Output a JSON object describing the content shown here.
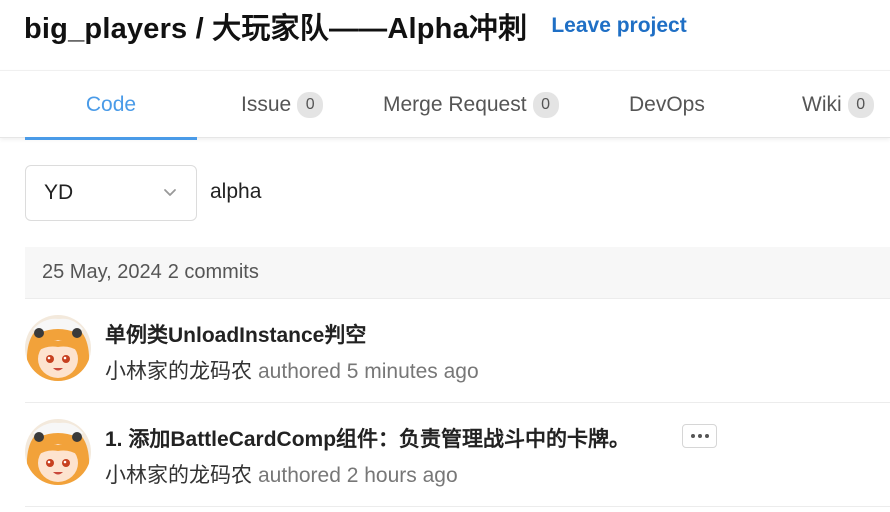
{
  "header": {
    "project_title": "big_players / 大玩家队——Alpha冲刺",
    "leave_label": "Leave project"
  },
  "tabs": [
    {
      "label": "Code",
      "active": true
    },
    {
      "label": "Issue",
      "count": "0"
    },
    {
      "label": "Merge Request",
      "count": "0"
    },
    {
      "label": "DevOps"
    },
    {
      "label": "Wiki",
      "count": "0"
    }
  ],
  "branch": {
    "selected": "YD"
  },
  "path": "alpha",
  "commit_group": {
    "date": "25 May, 2024",
    "count_text": "2 commits"
  },
  "commits": [
    {
      "message": "单例类UnloadInstance判空",
      "author": "小林家的龙码农",
      "meta": "authored 5 minutes ago"
    },
    {
      "message": "1. 添加BattleCardComp组件：负责管理战斗中的卡牌。",
      "author": "小林家的龙码农",
      "meta": "authored 2 hours ago"
    }
  ],
  "colors": {
    "accent": "#4a9be8",
    "link": "#1f6fc5"
  }
}
